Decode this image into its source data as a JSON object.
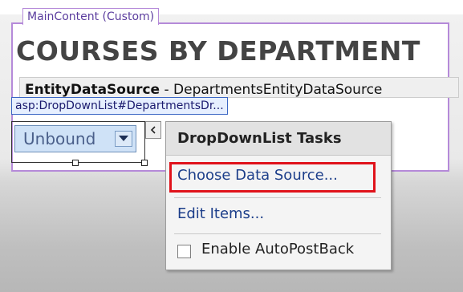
{
  "main_content": {
    "tab_label": "MainContent (Custom)"
  },
  "page": {
    "heading": "COURSES BY DEPARTMENT"
  },
  "entity_source": {
    "type": "EntityDataSource",
    "separator": " - ",
    "id": "DepartmentsEntityDataSource"
  },
  "control": {
    "tag": "asp:DropDownList#DepartmentsDr..."
  },
  "dropdown": {
    "value": "Unbound"
  },
  "tasks": {
    "title": "DropDownList Tasks",
    "choose_data_source": "Choose Data Source...",
    "edit_items": "Edit Items...",
    "enable_autopostback": "Enable AutoPostBack",
    "enable_autopostback_checked": false
  },
  "colors": {
    "purple_border": "#b58ad9",
    "highlight_red": "#e0121a",
    "link_blue": "#1c3e8a"
  },
  "icons": {
    "dropdown": "chevron-down-icon",
    "smart_tag": "chevron-left-icon"
  }
}
